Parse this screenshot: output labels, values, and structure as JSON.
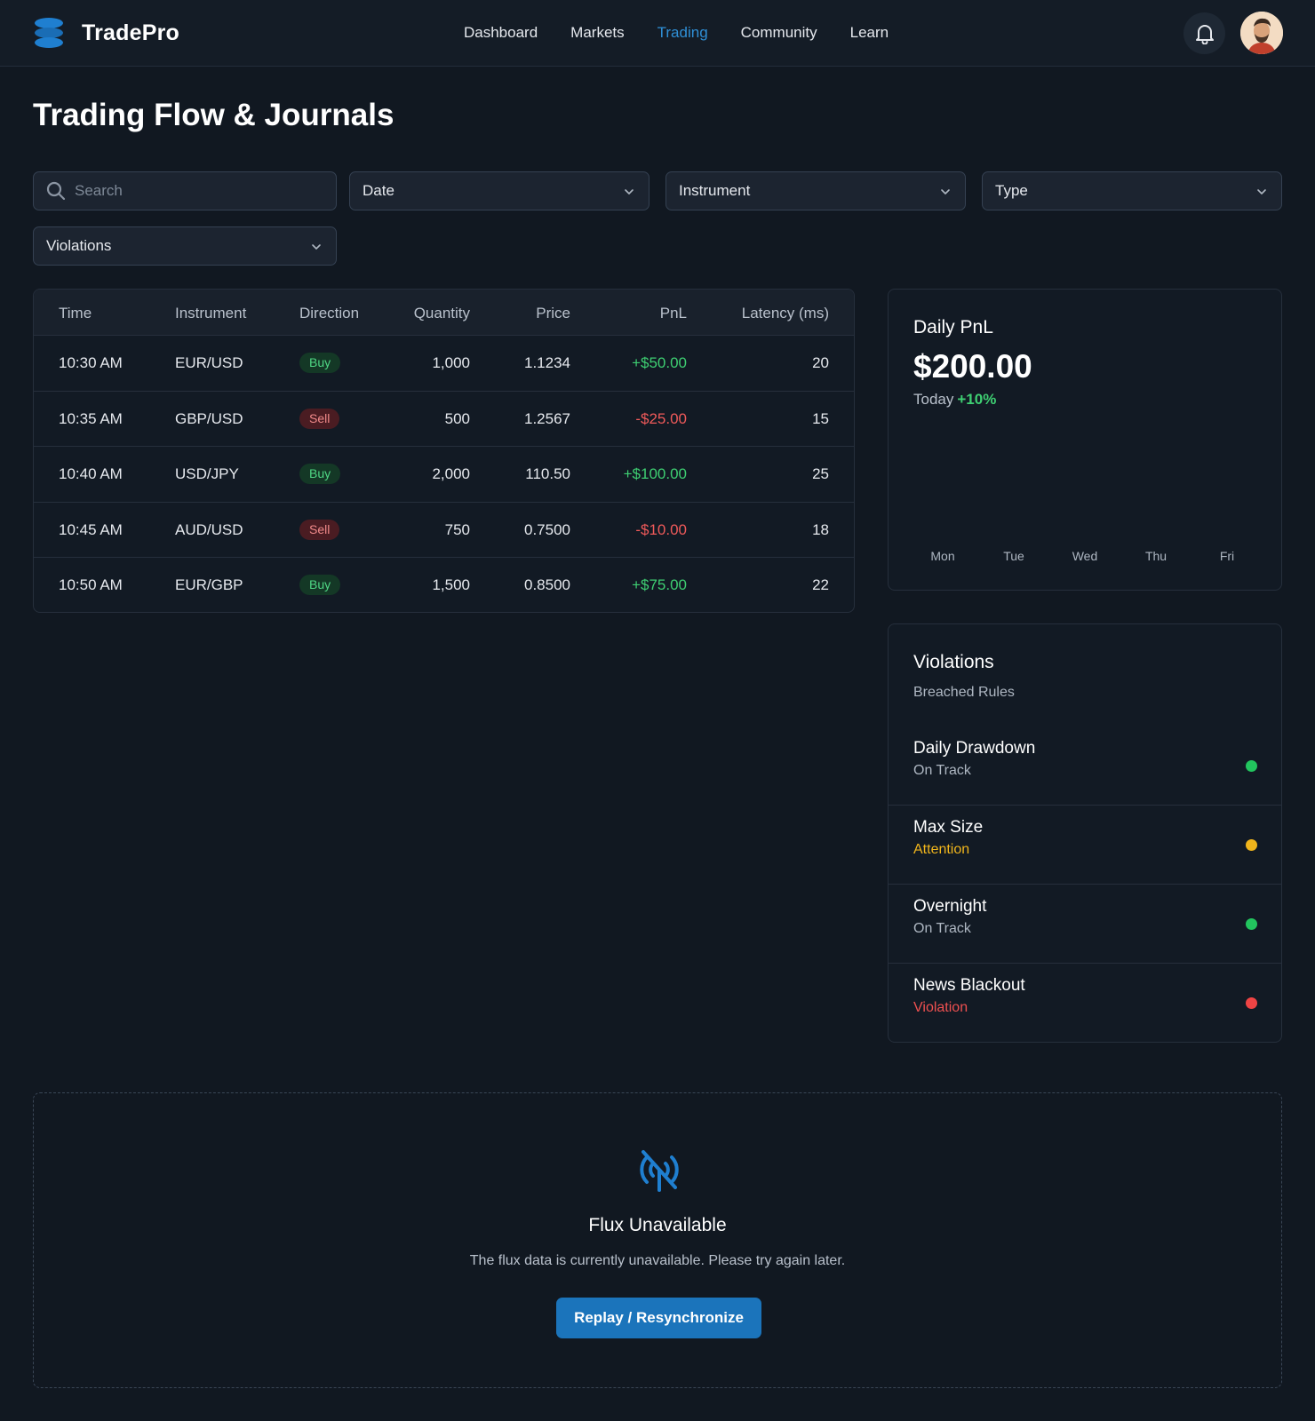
{
  "app": {
    "name": "TradePro"
  },
  "nav": {
    "items": [
      {
        "label": "Dashboard",
        "active": false
      },
      {
        "label": "Markets",
        "active": false
      },
      {
        "label": "Trading",
        "active": true
      },
      {
        "label": "Community",
        "active": false
      },
      {
        "label": "Learn",
        "active": false
      }
    ]
  },
  "icons": {
    "brand": "layers-logo-icon",
    "notifications": "bell-icon",
    "profile": "avatar",
    "search": "search-icon",
    "dropdown": "chevron-down-icon",
    "flux": "signal-off-icon"
  },
  "colors": {
    "accent": "#2f8fd6",
    "positive": "#3ecf72",
    "negative": "#ef5a5a",
    "warning": "#f0b51c",
    "button": "#1b74bb",
    "background": "#111821"
  },
  "page": {
    "title": "Trading Flow & Journals"
  },
  "filters": {
    "search": {
      "placeholder": "Search",
      "value": ""
    },
    "date": "Date",
    "instrument": "Instrument",
    "type": "Type",
    "violations": "Violations"
  },
  "table": {
    "headers": [
      "Time",
      "Instrument",
      "Direction",
      "Quantity",
      "Price",
      "PnL",
      "Latency (ms)"
    ],
    "rows": [
      {
        "time": "10:30 AM",
        "instrument": "EUR/USD",
        "direction": "Buy",
        "quantity": "1,000",
        "price": "1.1234",
        "pnl": "+$50.00",
        "latency": "20"
      },
      {
        "time": "10:35 AM",
        "instrument": "GBP/USD",
        "direction": "Sell",
        "quantity": "500",
        "price": "1.2567",
        "pnl": "-$25.00",
        "latency": "15"
      },
      {
        "time": "10:40 AM",
        "instrument": "USD/JPY",
        "direction": "Buy",
        "quantity": "2,000",
        "price": "110.50",
        "pnl": "+$100.00",
        "latency": "25"
      },
      {
        "time": "10:45 AM",
        "instrument": "AUD/USD",
        "direction": "Sell",
        "quantity": "750",
        "price": "0.7500",
        "pnl": "-$10.00",
        "latency": "18"
      },
      {
        "time": "10:50 AM",
        "instrument": "EUR/GBP",
        "direction": "Buy",
        "quantity": "1,500",
        "price": "0.8500",
        "pnl": "+$75.00",
        "latency": "22"
      }
    ]
  },
  "daily_pnl": {
    "title": "Daily PnL",
    "value": "$200.00",
    "period": "Today",
    "change": "+10%",
    "days": [
      "Mon",
      "Tue",
      "Wed",
      "Thu",
      "Fri"
    ]
  },
  "violations": {
    "title": "Violations",
    "subtitle": "Breached Rules",
    "rules": [
      {
        "name": "Daily Drawdown",
        "status": "On Track",
        "level": "ok",
        "dot_color": "#22c55e"
      },
      {
        "name": "Max Size",
        "status": "Attention",
        "level": "attn",
        "dot_color": "#f0b51c"
      },
      {
        "name": "Overnight",
        "status": "On Track",
        "level": "ok",
        "dot_color": "#22c55e"
      },
      {
        "name": "News Blackout",
        "status": "Violation",
        "level": "viol",
        "dot_color": "#ef4444"
      }
    ]
  },
  "flux": {
    "title": "Flux Unavailable",
    "message": "The flux data is currently unavailable. Please try again later.",
    "button": "Replay / Resynchronize"
  }
}
